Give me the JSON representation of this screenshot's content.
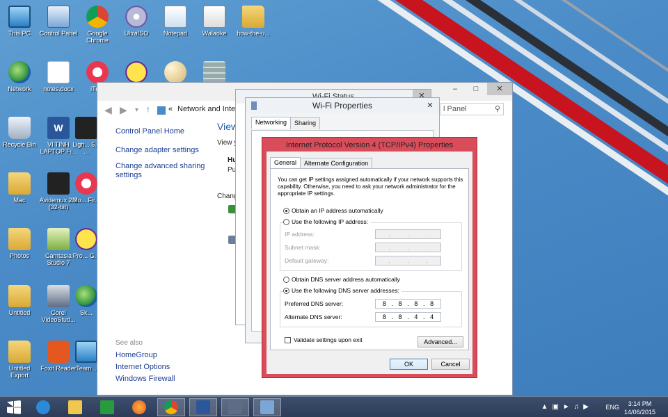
{
  "desktop": {
    "icons": [
      {
        "label": "This PC"
      },
      {
        "label": "Control Panel"
      },
      {
        "label": "Google Chrome"
      },
      {
        "label": "UltraISO"
      },
      {
        "label": "Notepad"
      },
      {
        "label": "Walaoke"
      },
      {
        "label": "how-the-u..."
      },
      {
        "label": "Network"
      },
      {
        "label": "notes.docx"
      },
      {
        "label": "iTu..."
      },
      {
        "label": "Recycle Bin"
      },
      {
        "label": "VI TINH LAPTOP Fi..."
      },
      {
        "label": "Ligh... 5.5 ..."
      },
      {
        "label": "Mac"
      },
      {
        "label": "Avidemux 2.6 (32-bit)"
      },
      {
        "label": "Mo... Fir..."
      },
      {
        "label": "Photos"
      },
      {
        "label": "Camtasia Studio 7"
      },
      {
        "label": "Pro... G..."
      },
      {
        "label": "Untitled"
      },
      {
        "label": "Corel VideoStud..."
      },
      {
        "label": "Sk..."
      },
      {
        "label": "Untitled Export"
      },
      {
        "label": "Foxit Reader"
      },
      {
        "label": "Team..."
      }
    ]
  },
  "taskbar": {
    "language": "ENG",
    "time": "3:14 PM",
    "date": "14/06/2015"
  },
  "nsc": {
    "breadcrumb_prefix": "«",
    "breadcrumb": "Network and Internet",
    "search_placeholder": "l Panel",
    "side_home": "Control Panel Home",
    "side_links": [
      "Change adapter settings",
      "Change advanced sharing settings"
    ],
    "see_also": "See also",
    "see_also_links": [
      "HomeGroup",
      "Internet Options",
      "Windows Firewall"
    ],
    "main_title": "View",
    "frag_view": "View yo",
    "frag_hu": "Hu",
    "frag_pub": "Pub",
    "frag_change": "Chang"
  },
  "wifi_status": {
    "title": "Wi-Fi Status"
  },
  "wifi_props": {
    "title": "Wi-Fi Properties",
    "tabs": [
      "Networking",
      "Sharing"
    ]
  },
  "ipv4": {
    "title": "Internet Protocol Version 4 (TCP/IPv4) Properties",
    "tabs": [
      "General",
      "Alternate Configuration"
    ],
    "description": "You can get IP settings assigned automatically if your network supports this capability. Otherwise, you need to ask your network administrator for the appropriate IP settings.",
    "ip_auto": "Obtain an IP address automatically",
    "ip_manual": "Use the following IP address:",
    "ip_address_label": "IP address:",
    "subnet_label": "Subnet mask:",
    "gateway_label": "Default gateway:",
    "dns_auto": "Obtain DNS server address automatically",
    "dns_manual": "Use the following DNS server addresses:",
    "preferred_dns_label": "Preferred DNS server:",
    "alternate_dns_label": "Alternate DNS server:",
    "preferred_dns": [
      "8",
      "8",
      "8",
      "8"
    ],
    "alternate_dns": [
      "8",
      "8",
      "4",
      "4"
    ],
    "validate_label": "Validate settings upon exit",
    "advanced_label": "Advanced...",
    "ok_label": "OK",
    "cancel_label": "Cancel"
  }
}
